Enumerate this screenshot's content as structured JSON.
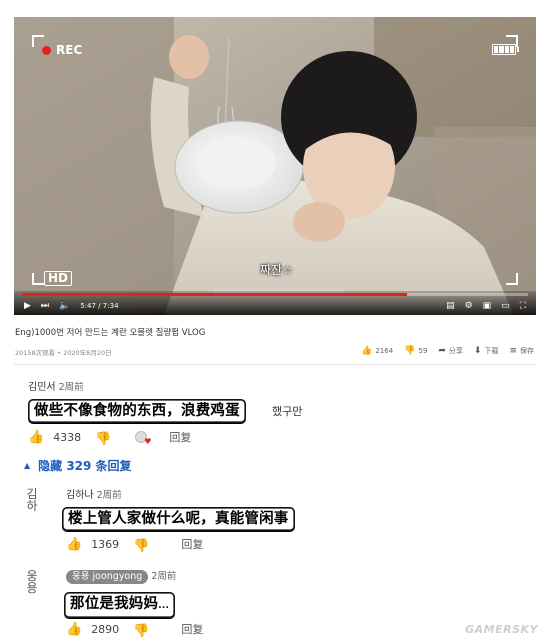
{
  "player": {
    "rec_label": "REC",
    "hd_label": "HD",
    "caption_text": "짜잔☆",
    "time_current": "5:47",
    "time_total": "7:34",
    "progress": 0.76
  },
  "video": {
    "title": "Eng)1000번 저어 만드는 계란 오믈렛 질량펌 VLOG",
    "meta": "20158次观看 • 2020年8月20日",
    "likes": "2164",
    "dislikes": "59",
    "share_label": "分享",
    "download_label": "下载",
    "save_label": "保存"
  },
  "comments": [
    {
      "author": "김민서",
      "time": "2周前",
      "text": "做些不像食物的东西，浪费鸡蛋",
      "tail": "했구만",
      "likes": "4338",
      "reply_label": "回复"
    },
    {
      "avatar_text": "김\n하",
      "author": "김하나",
      "time": "2周前",
      "text": "楼上管人家做什么呢，真能管闲事",
      "likes": "1369",
      "reply_label": "回复"
    },
    {
      "avatar_text": "웅\n용",
      "author_chip": "웅용 joongyong",
      "time": "2周前",
      "text": "那位是我妈妈",
      "tail": "...",
      "likes": "2890",
      "reply_label": "回复"
    }
  ],
  "replies_toggle": {
    "label": "隐藏 329 条回复"
  },
  "watermark": "GAMERSKY",
  "colors": {
    "accent": "#e3221b",
    "link": "#1a5ec2"
  },
  "icons": [
    "record-dot-icon",
    "battery-icon",
    "play-icon",
    "next-icon",
    "volume-icon",
    "settings-icon",
    "fullscreen-icon",
    "thumbs-up-icon",
    "thumbs-down-icon",
    "share-icon",
    "download-icon",
    "save-icon",
    "heart-icon",
    "chevron-up-icon"
  ]
}
